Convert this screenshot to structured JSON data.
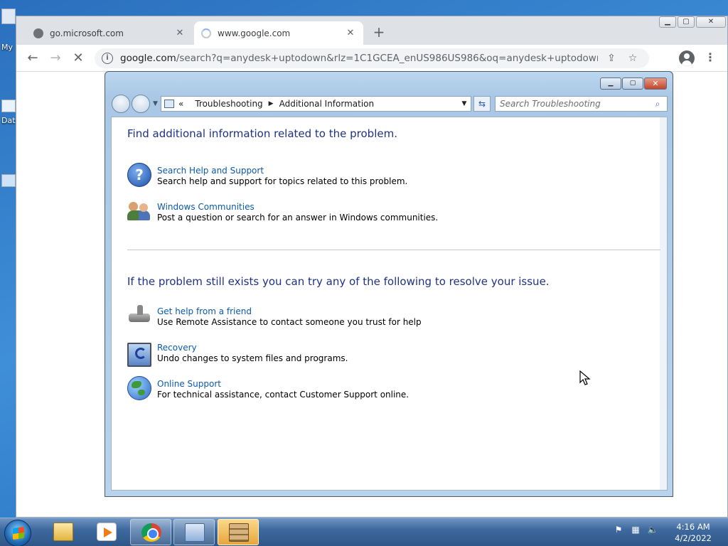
{
  "desktop": {
    "labels": [
      "My",
      "Dat"
    ]
  },
  "browser": {
    "tabs": [
      {
        "title": "go.microsoft.com",
        "state": "inactive"
      },
      {
        "title": "www.google.com",
        "state": "loading"
      }
    ],
    "new_tab_glyph": "+",
    "url_host": "google.com",
    "url_rest": "/search?q=anydesk+uptodown&rlz=1C1GCEA_enUS986US986&oq=anydesk+uptodown&aqs=chro...",
    "icons": [
      "back-arrow-icon",
      "forward-arrow-icon",
      "stop-icon",
      "site-info-icon",
      "share-icon",
      "bookmark-star-icon",
      "profile-icon",
      "kebab-menu-icon"
    ]
  },
  "troubleshooting": {
    "breadcrumb": {
      "overflow": "«",
      "items": [
        "Troubleshooting",
        "Additional Information"
      ]
    },
    "search_placeholder": "Search Troubleshooting",
    "section1": {
      "heading": "Find additional information related to the problem.",
      "items": [
        {
          "link": "Search Help and Support",
          "desc": "Search help and support for topics related to this problem.",
          "icon": "help-icon"
        },
        {
          "link": "Windows Communities",
          "desc": "Post a question or search for an answer in Windows communities.",
          "icon": "people-icon"
        }
      ]
    },
    "section2": {
      "heading": "If the problem still exists you can try any of the following to resolve your issue.",
      "items": [
        {
          "link": "Get help from a friend",
          "desc": "Use Remote Assistance to contact someone you trust for help",
          "icon": "remote-assistance-icon"
        },
        {
          "link": "Recovery",
          "desc": "Undo changes to system files and programs.",
          "icon": "recovery-icon"
        },
        {
          "link": "Online Support",
          "desc": "For technical assistance, contact Customer Support online.",
          "icon": "globe-icon"
        }
      ]
    }
  },
  "taskbar": {
    "items": [
      "explorer",
      "media-player",
      "chrome",
      "control-panel",
      "firewall"
    ],
    "clock_time": "4:16 AM",
    "clock_date": "4/2/2022"
  }
}
